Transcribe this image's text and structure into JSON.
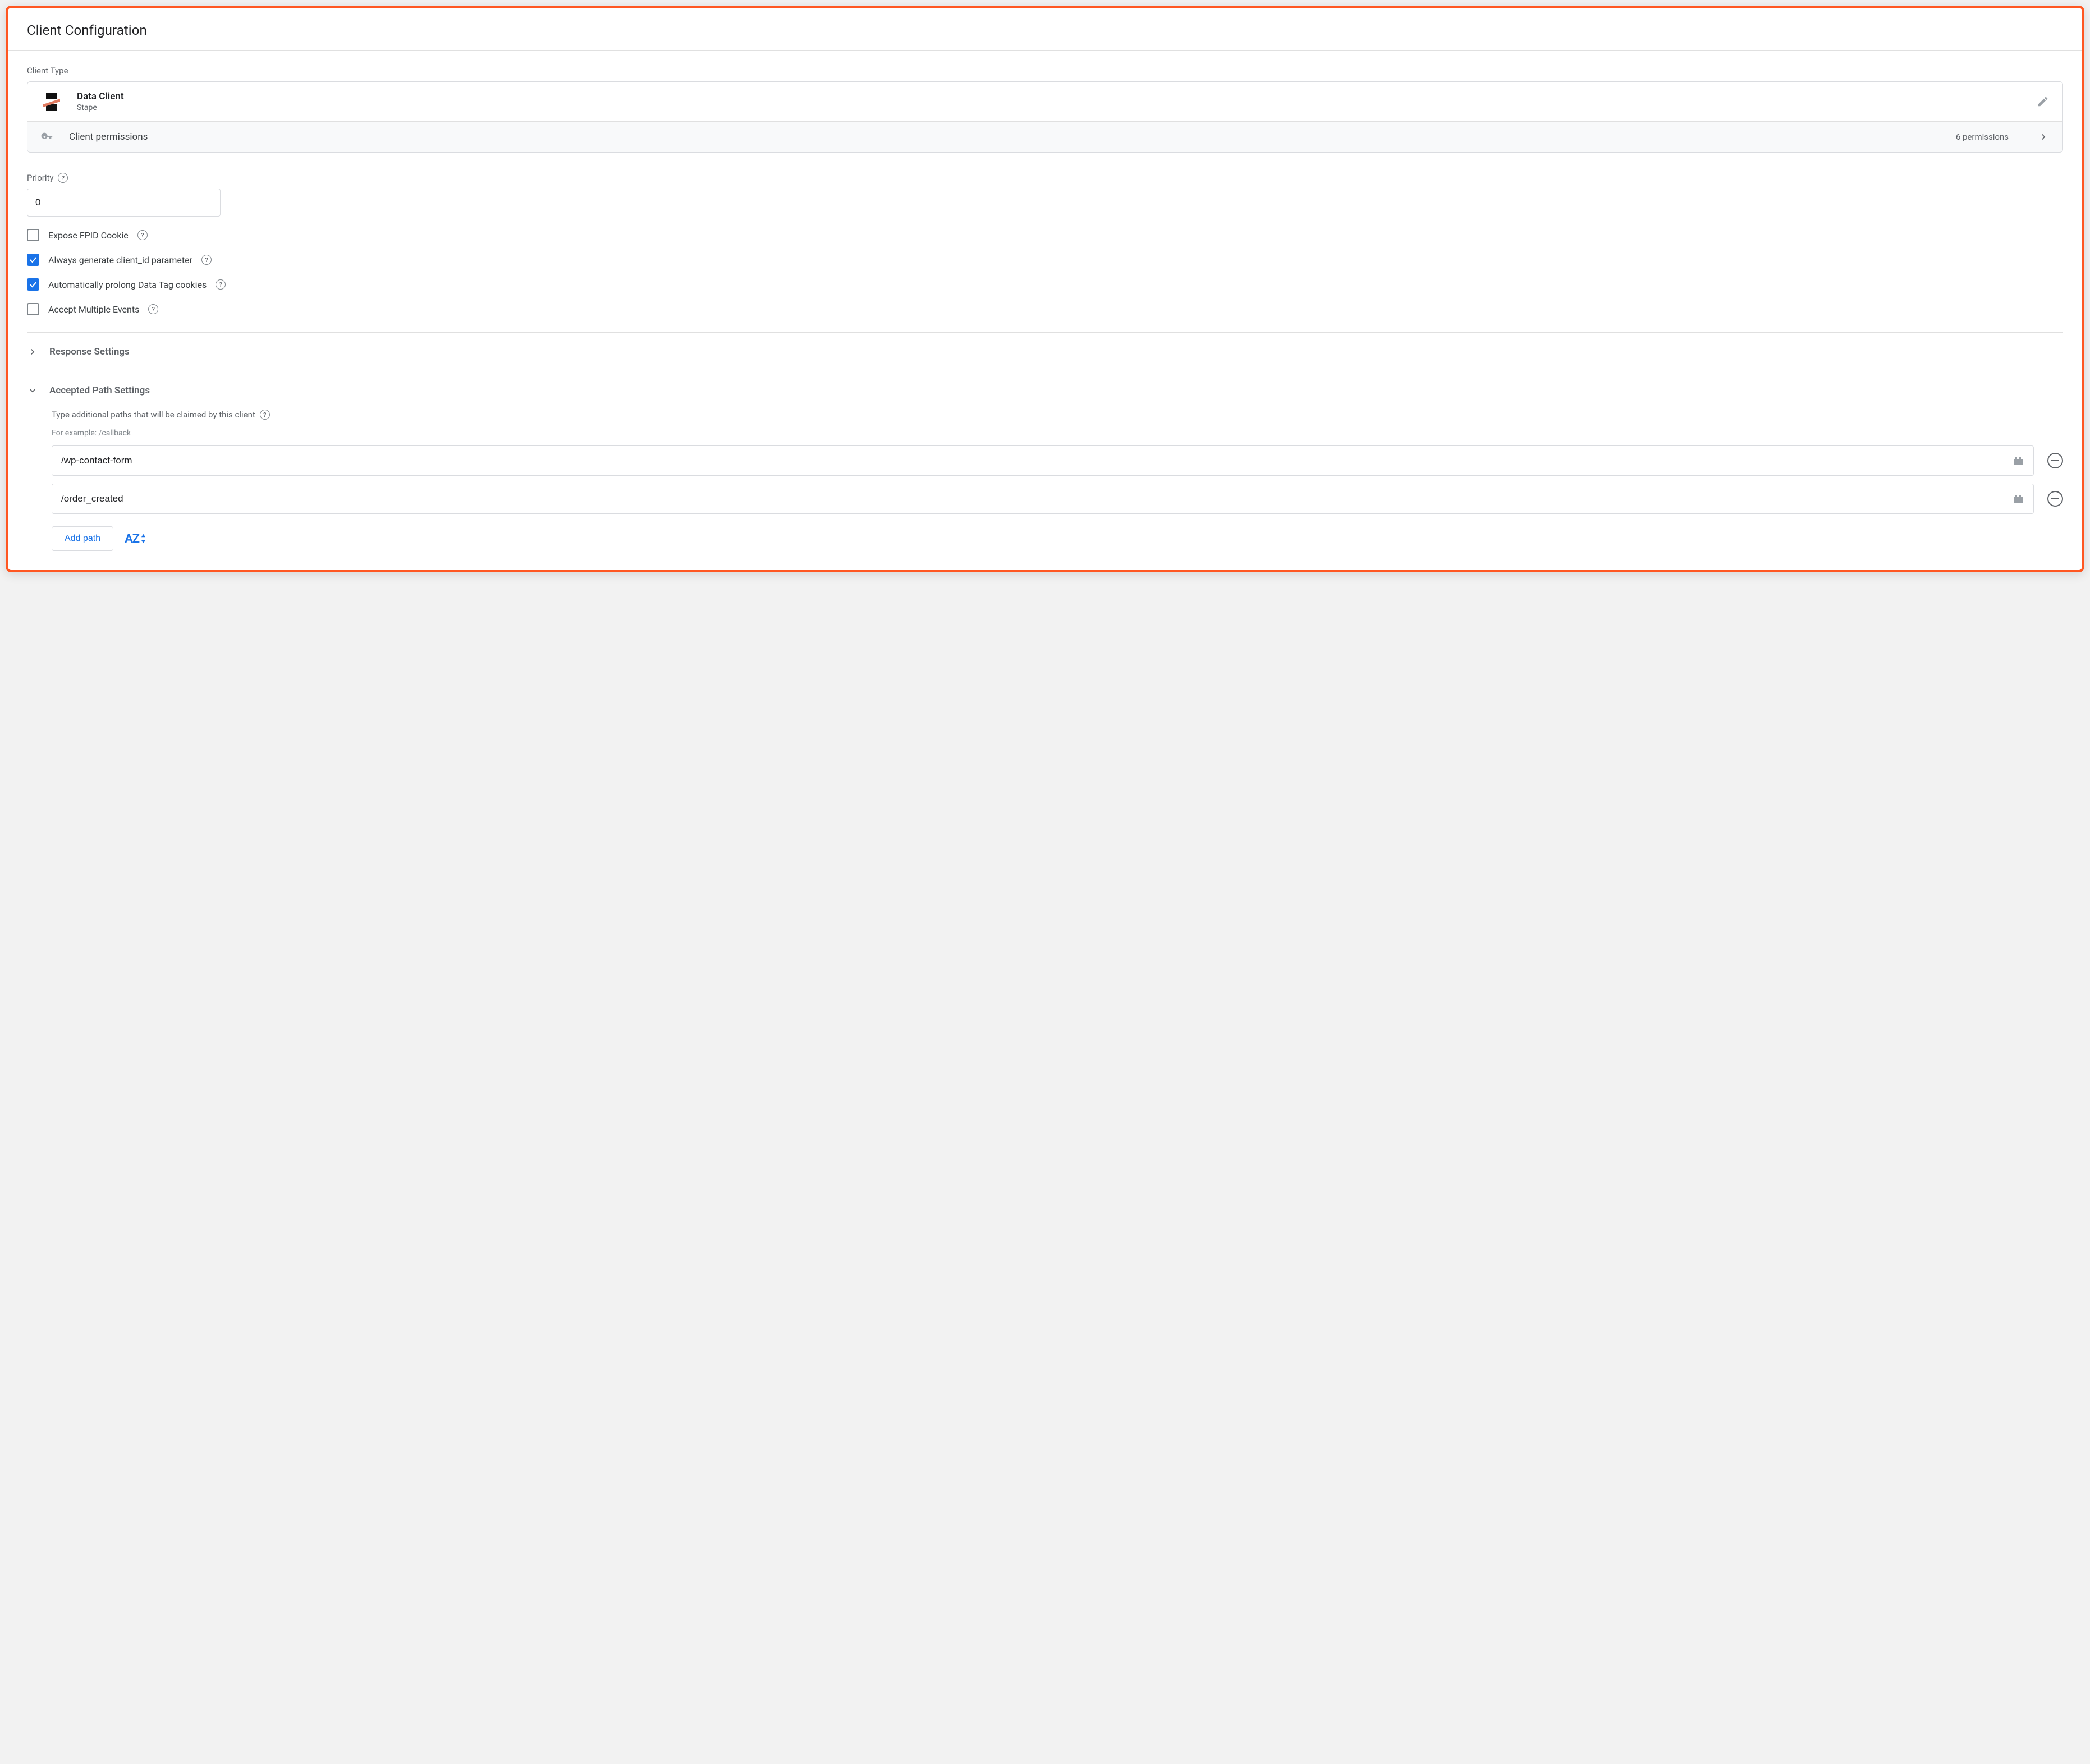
{
  "header": {
    "title": "Client Configuration"
  },
  "clientType": {
    "label": "Client Type",
    "name": "Data Client",
    "vendor": "Stape"
  },
  "permissions": {
    "label": "Client permissions",
    "count": "6 permissions"
  },
  "priority": {
    "label": "Priority",
    "value": "0"
  },
  "checkboxes": {
    "expose_fpid": "Expose FPID Cookie",
    "always_client_id": "Always generate client_id parameter",
    "auto_prolong": "Automatically prolong Data Tag cookies",
    "accept_multiple": "Accept Multiple Events"
  },
  "responseSettings": {
    "title": "Response Settings"
  },
  "acceptedPaths": {
    "title": "Accepted Path Settings",
    "helper": "Type additional paths that will be claimed by this client",
    "example": "For example: /callback",
    "paths": [
      "/wp-contact-form",
      "/order_created"
    ],
    "add_label": "Add path",
    "sort_label": "AZ"
  }
}
